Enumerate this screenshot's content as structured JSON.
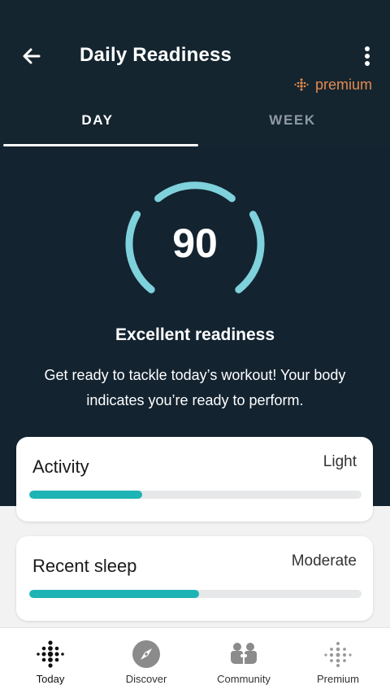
{
  "header": {
    "title": "Daily Readiness",
    "back_icon": "arrow-left-icon",
    "menu_icon": "more-vertical-icon",
    "premium_label": "premium",
    "premium_color": "#e58a4d"
  },
  "tabs": [
    {
      "label": "DAY",
      "selected": true
    },
    {
      "label": "WEEK",
      "selected": false
    }
  ],
  "readiness": {
    "score": "90",
    "status": "Excellent readiness",
    "description": "Get ready to tackle today’s workout! Your body indicates you’re ready to perform.",
    "gauge_color": "#7fd1dc"
  },
  "cards": [
    {
      "label": "Activity",
      "value": "Light",
      "progress": 0.34
    },
    {
      "label": "Recent sleep",
      "value": "Moderate",
      "progress": 0.51
    }
  ],
  "bar_color": "#1eb3b4",
  "bottom_nav": [
    {
      "label": "Today",
      "icon": "fitbit-dots-icon",
      "active": true
    },
    {
      "label": "Discover",
      "icon": "compass-icon",
      "active": false
    },
    {
      "label": "Community",
      "icon": "community-people-icon",
      "active": false
    },
    {
      "label": "Premium",
      "icon": "premium-dots-icon",
      "active": false
    }
  ],
  "colors": {
    "background_dark": "#132330",
    "header_dark": "#15252f",
    "surface_light": "#f2f2f3"
  }
}
